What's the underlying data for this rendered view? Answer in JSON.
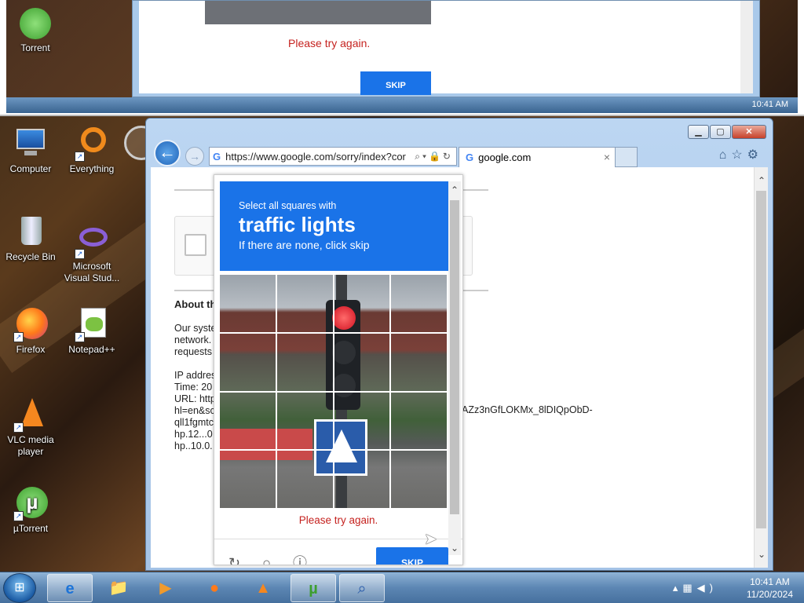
{
  "desktop": {
    "icons": [
      {
        "label": "Computer"
      },
      {
        "label": "Everything"
      },
      {
        "label": "Recycle Bin"
      },
      {
        "label": "Microsoft Visual Stud..."
      },
      {
        "label": "Firefox"
      },
      {
        "label": "Notepad++"
      },
      {
        "label": "VLC media player"
      },
      {
        "label": "µTorrent"
      }
    ]
  },
  "top_screenshot": {
    "icon_label": "Torrent",
    "error_text": "Please try again.",
    "skip_label": "SKIP",
    "clock": "10:41 AM"
  },
  "browser": {
    "address_url": "https://www.google.com/sorry/index?cor",
    "tab_title": "google.com",
    "back_glyph": "←",
    "forward_glyph": "→",
    "page": {
      "about_heading": "About th",
      "about_text": "Our syste\nnetwork.\nrequests\n\nIP addres\nTime: 20\nURL: http\nhl=en&sc\nqll1fgmtc\nhp.12...0\nhp..10.0.",
      "url_tail": "AZz3nGfLOKMx_8lDIQpObD-"
    }
  },
  "captcha": {
    "line1": "Select all squares with",
    "line2": "traffic lights",
    "line3": "If there are none, click skip",
    "error": "Please try again.",
    "skip_label": "SKIP"
  },
  "taskbar": {
    "time": "10:41 AM",
    "date": "11/20/2024"
  },
  "colors": {
    "captcha_blue": "#1a73e8",
    "error_red": "#c5221f"
  }
}
